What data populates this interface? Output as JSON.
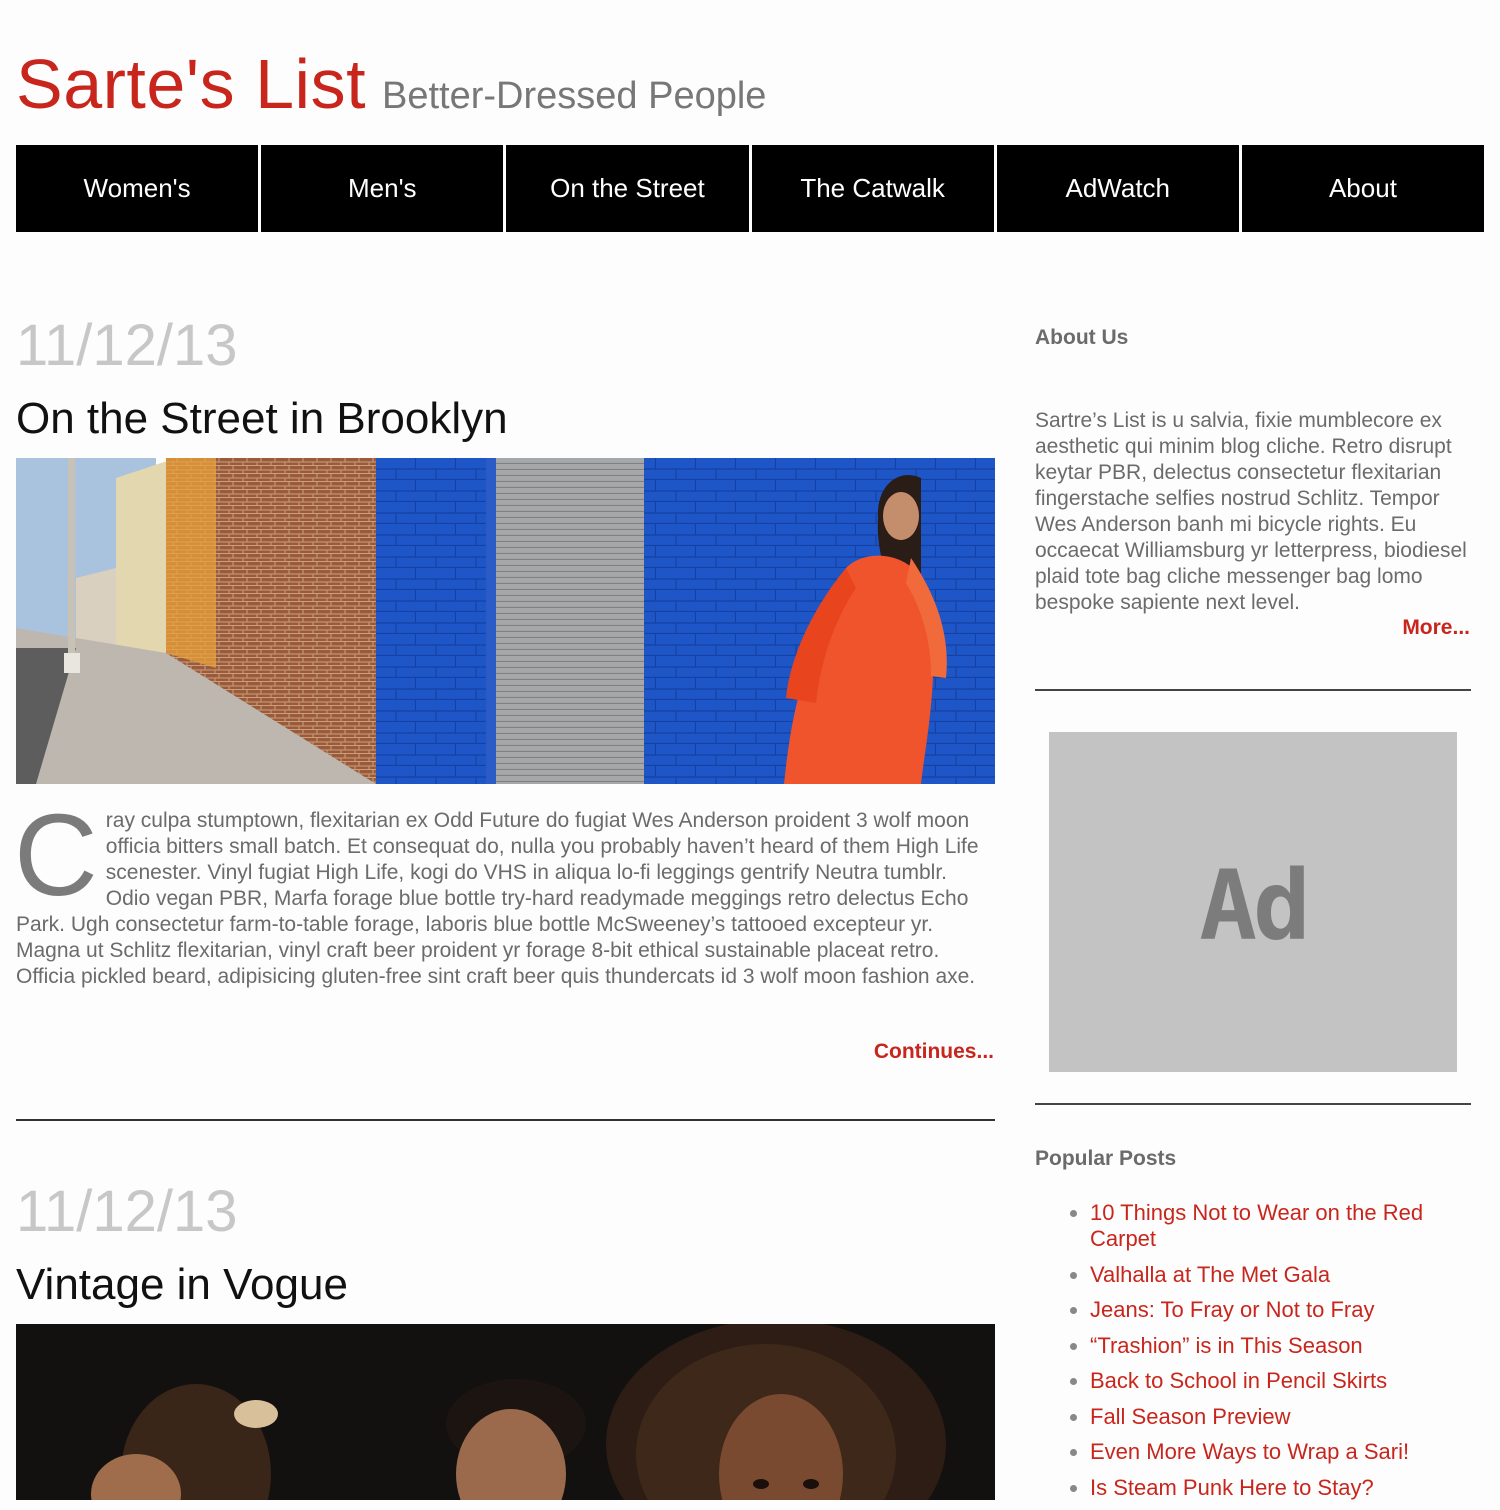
{
  "header": {
    "site_title": "Sarte's List",
    "tagline": "Better-Dressed People"
  },
  "nav": {
    "items": [
      "Women's",
      "Men's",
      "On the Street",
      "The Catwalk",
      "AdWatch",
      "About"
    ]
  },
  "posts": [
    {
      "date": "11/12/13",
      "title": "On the Street in Brooklyn",
      "dropcap": "C",
      "excerpt": "ray culpa stumptown, flexitarian ex Odd Future do fugiat Wes Anderson proident 3 wolf moon officia bitters small batch. Et consequat do, nulla you probably haven’t heard of them High Life scenester. Vinyl fugiat High Life, kogi do VHS in aliqua lo-fi leggings gentrify Neutra tumblr. Odio vegan PBR, Marfa forage blue bottle try-hard readymade meggings retro delectus Echo Park. Ugh consectetur farm-to-table forage, laboris blue bottle McSweeney’s tattooed excepteur yr. Magna ut Schlitz flexitarian, vinyl craft beer proident yr forage 8-bit ethical sustainable placeat retro. Officia pickled beard, adipisicing gluten-free sint craft beer quis thundercats id 3 wolf moon fashion axe.",
      "continue_label": "Continues..."
    },
    {
      "date": "11/12/13",
      "title": "Vintage in Vogue"
    }
  ],
  "sidebar": {
    "about_heading": "About Us",
    "about_text": "Sartre’s List is u salvia, fixie mumblecore ex aesthetic qui minim blog cliche. Retro disrupt keytar PBR, delectus consectetur flexitarian fingerstache selfies nostrud Schlitz. Tempor Wes Anderson banh mi bicycle rights. Eu occaecat Williamsburg yr letterpress, biodiesel plaid tote bag cliche messenger bag lomo bespoke sapiente next level.",
    "more_label": "More...",
    "ad_label": "Ad",
    "popular_heading": "Popular Posts",
    "popular_posts": [
      "10 Things Not to Wear on the Red Carpet",
      "Valhalla at The Met Gala",
      "Jeans: To Fray or Not to Fray",
      "“Trashion” is in This Season",
      "Back to School in Pencil Skirts",
      "Fall Season Preview",
      "Even More Ways to Wrap a Sari!",
      "Is Steam Punk Here to Stay?"
    ]
  },
  "colors": {
    "brand_red": "#c8261c",
    "nav_background": "#000000",
    "date_gray": "#c7c7c7",
    "ad_background": "#c3c3c3"
  }
}
